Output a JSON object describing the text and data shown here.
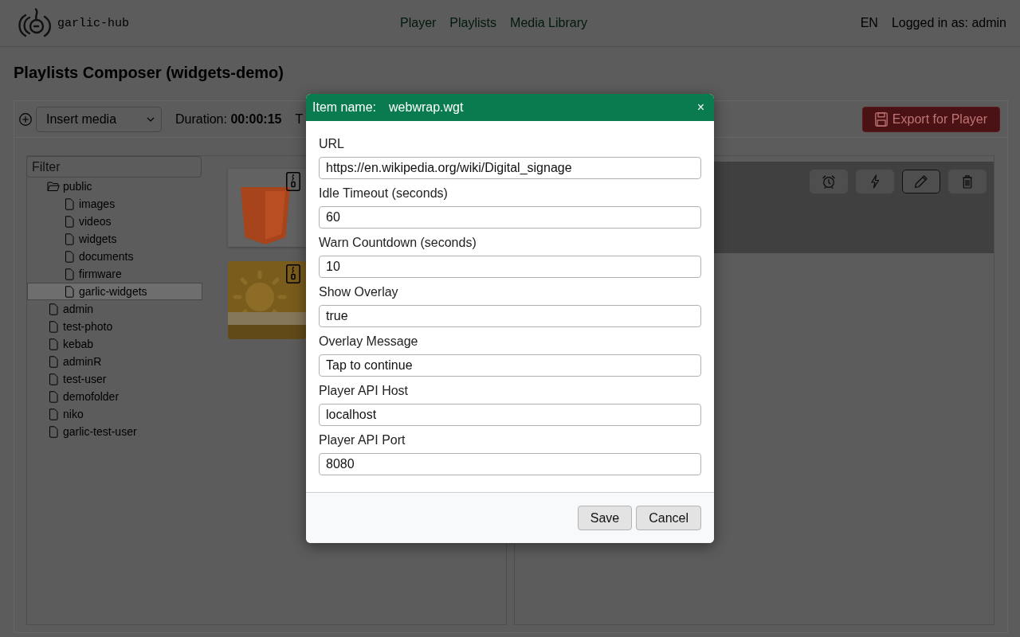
{
  "header": {
    "logo_text": "garlic-hub",
    "nav": [
      "Player",
      "Playlists",
      "Media Library"
    ],
    "language": "EN",
    "user_label": "Logged in as: admin"
  },
  "page_title": "Playlists Composer (widgets-demo)",
  "toolbar": {
    "insert_select": "Insert media",
    "duration": "Duration: **00:00:15**",
    "partial_label": "T",
    "export_button": "Export for Player"
  },
  "tree": {
    "filter_placeholder": "Filter",
    "items": [
      {
        "label": "public",
        "expanded": true,
        "selected": false,
        "children": [
          {
            "label": "images",
            "expanded": false,
            "selected": false
          },
          {
            "label": "videos",
            "expanded": false,
            "selected": false
          },
          {
            "label": "widgets",
            "expanded": false,
            "selected": false
          },
          {
            "label": "documents",
            "expanded": false,
            "selected": false
          },
          {
            "label": "firmware",
            "expanded": false,
            "selected": false
          },
          {
            "label": "garlic-widgets",
            "expanded": false,
            "selected": true
          }
        ]
      },
      {
        "label": "admin",
        "expanded": false,
        "selected": false
      },
      {
        "label": "test-photo",
        "expanded": false,
        "selected": false
      },
      {
        "label": "kebab",
        "expanded": false,
        "selected": false
      },
      {
        "label": "adminR",
        "expanded": false,
        "selected": false
      },
      {
        "label": "test-user",
        "expanded": false,
        "selected": false
      },
      {
        "label": "demofolder",
        "expanded": false,
        "selected": false
      },
      {
        "label": "niko",
        "expanded": false,
        "selected": false
      },
      {
        "label": "garlic-test-user",
        "expanded": false,
        "selected": false
      }
    ]
  },
  "media_items": [
    {
      "kind": "html5"
    },
    {
      "kind": "weather"
    }
  ],
  "playlist_item": {
    "actions": [
      {
        "kind": "alarm",
        "selected": false
      },
      {
        "kind": "bolt",
        "selected": false
      },
      {
        "kind": "edit",
        "selected": true
      },
      {
        "kind": "delete",
        "selected": false
      }
    ]
  },
  "dialog": {
    "title_label": "Item name:",
    "item_name": "webwrap.wgt",
    "close_label": "×",
    "fields": [
      {
        "label": "URL",
        "value": "https://en.wikipedia.org/wiki/Digital_signage"
      },
      {
        "label": "Idle Timeout (seconds)",
        "value": "60"
      },
      {
        "label": "Warn Countdown (seconds)",
        "value": "10"
      },
      {
        "label": "Show Overlay",
        "value": "true"
      },
      {
        "label": "Overlay Message",
        "value": "Tap to continue"
      },
      {
        "label": "Player API Host",
        "value": "localhost"
      },
      {
        "label": "Player API Port",
        "value": "8080"
      }
    ],
    "buttons": [
      "Save",
      "Cancel"
    ]
  }
}
